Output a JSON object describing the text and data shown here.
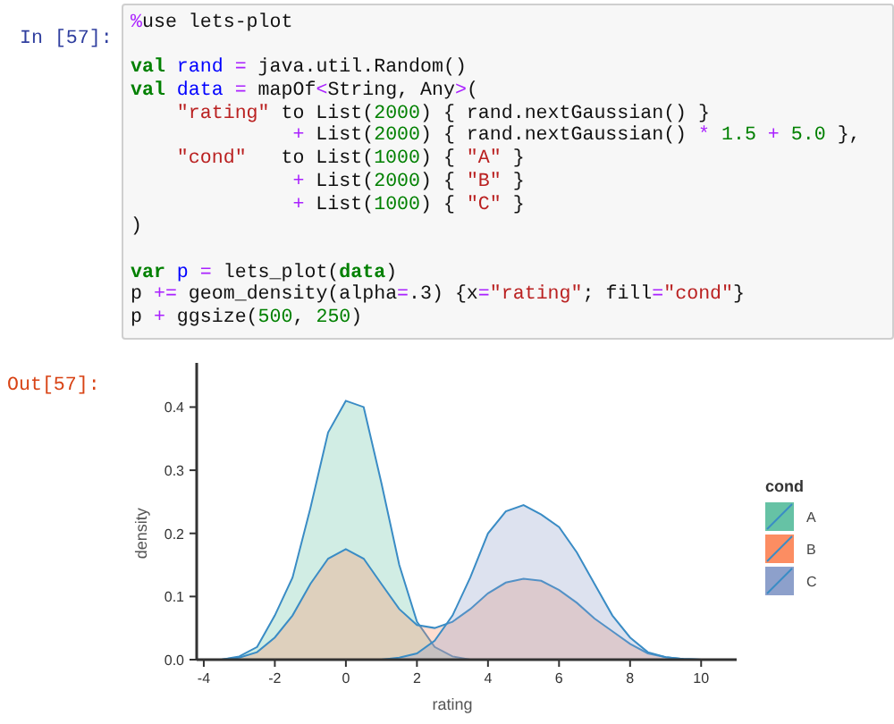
{
  "input_cell": {
    "prompt": "In [57]:",
    "lines": [
      {
        "tokens": [
          {
            "kind": "op",
            "text": "%"
          },
          {
            "kind": "plain",
            "text": "use lets-plot"
          }
        ]
      },
      {
        "blank_before": true,
        "tokens": [
          {
            "kind": "kw",
            "text": "val "
          },
          {
            "kind": "var",
            "text": "rand "
          },
          {
            "kind": "op",
            "text": "="
          },
          {
            "kind": "plain",
            "text": " java.util.Random()"
          }
        ]
      },
      {
        "tokens": [
          {
            "kind": "kw",
            "text": "val "
          },
          {
            "kind": "var",
            "text": "data "
          },
          {
            "kind": "op",
            "text": "="
          },
          {
            "kind": "plain",
            "text": " mapOf"
          },
          {
            "kind": "op",
            "text": "<"
          },
          {
            "kind": "plain",
            "text": "String, Any"
          },
          {
            "kind": "op",
            "text": ">"
          },
          {
            "kind": "plain",
            "text": "("
          }
        ]
      },
      {
        "tokens": [
          {
            "kind": "str",
            "text": "    \"rating\""
          },
          {
            "kind": "plain",
            "text": " to List("
          },
          {
            "kind": "num",
            "text": "2000"
          },
          {
            "kind": "plain",
            "text": ") { rand.nextGaussian() }"
          }
        ]
      },
      {
        "tokens": [
          {
            "kind": "op",
            "text": "              +"
          },
          {
            "kind": "plain",
            "text": " List("
          },
          {
            "kind": "num",
            "text": "2000"
          },
          {
            "kind": "plain",
            "text": ") { rand.nextGaussian() "
          },
          {
            "kind": "op",
            "text": "* "
          },
          {
            "kind": "num",
            "text": "1.5 "
          },
          {
            "kind": "op",
            "text": "+ "
          },
          {
            "kind": "num",
            "text": "5.0"
          },
          {
            "kind": "plain",
            "text": " },"
          }
        ]
      },
      {
        "tokens": [
          {
            "kind": "str",
            "text": "    \"cond\""
          },
          {
            "kind": "plain",
            "text": "   to List("
          },
          {
            "kind": "num",
            "text": "1000"
          },
          {
            "kind": "plain",
            "text": ") { "
          },
          {
            "kind": "str",
            "text": "\"A\""
          },
          {
            "kind": "plain",
            "text": " }"
          }
        ]
      },
      {
        "tokens": [
          {
            "kind": "op",
            "text": "              +"
          },
          {
            "kind": "plain",
            "text": " List("
          },
          {
            "kind": "num",
            "text": "2000"
          },
          {
            "kind": "plain",
            "text": ") { "
          },
          {
            "kind": "str",
            "text": "\"B\""
          },
          {
            "kind": "plain",
            "text": " }"
          }
        ]
      },
      {
        "tokens": [
          {
            "kind": "op",
            "text": "              +"
          },
          {
            "kind": "plain",
            "text": " List("
          },
          {
            "kind": "num",
            "text": "1000"
          },
          {
            "kind": "plain",
            "text": ") { "
          },
          {
            "kind": "str",
            "text": "\"C\""
          },
          {
            "kind": "plain",
            "text": " }"
          }
        ]
      },
      {
        "tokens": [
          {
            "kind": "plain",
            "text": ")"
          }
        ]
      },
      {
        "blank_before": true,
        "tokens": [
          {
            "kind": "kw",
            "text": "var "
          },
          {
            "kind": "var",
            "text": "p "
          },
          {
            "kind": "op",
            "text": "="
          },
          {
            "kind": "plain",
            "text": " lets_plot("
          },
          {
            "kind": "kw",
            "text": "data"
          },
          {
            "kind": "plain",
            "text": ")"
          }
        ]
      },
      {
        "tokens": [
          {
            "kind": "plain",
            "text": "p "
          },
          {
            "kind": "op",
            "text": "+="
          },
          {
            "kind": "plain",
            "text": " geom_density(alpha"
          },
          {
            "kind": "op",
            "text": "="
          },
          {
            "kind": "plain",
            "text": ".3) {x"
          },
          {
            "kind": "op",
            "text": "="
          },
          {
            "kind": "str",
            "text": "\"rating\""
          },
          {
            "kind": "plain",
            "text": "; fill"
          },
          {
            "kind": "op",
            "text": "="
          },
          {
            "kind": "str",
            "text": "\"cond\""
          },
          {
            "kind": "plain",
            "text": "}"
          }
        ]
      },
      {
        "tokens": [
          {
            "kind": "plain",
            "text": "p "
          },
          {
            "kind": "op",
            "text": "+"
          },
          {
            "kind": "plain",
            "text": " ggsize("
          },
          {
            "kind": "num",
            "text": "500"
          },
          {
            "kind": "plain",
            "text": ", "
          },
          {
            "kind": "num",
            "text": "250"
          },
          {
            "kind": "plain",
            "text": ")"
          }
        ]
      }
    ]
  },
  "output_cell": {
    "prompt": "Out[57]:",
    "chart_data": {
      "type": "area",
      "xlabel": "rating",
      "ylabel": "density",
      "legend": {
        "title": "cond"
      },
      "x": [
        -3.5,
        -3,
        -2.5,
        -2,
        -1.5,
        -1,
        -0.5,
        0,
        0.5,
        1,
        1.5,
        2,
        2.5,
        3,
        3.5,
        4,
        4.5,
        5,
        5.5,
        6,
        6.5,
        7,
        7.5,
        8,
        8.5,
        9,
        9.5,
        10,
        10.5
      ],
      "series": [
        {
          "name": "A",
          "color": "#66c2a5",
          "values": [
            0,
            0.005,
            0.02,
            0.07,
            0.13,
            0.24,
            0.36,
            0.41,
            0.4,
            0.28,
            0.15,
            0.06,
            0.02,
            0.005,
            0,
            0,
            0,
            0,
            0,
            0,
            0,
            0,
            0,
            0,
            0,
            0,
            0,
            0,
            0
          ]
        },
        {
          "name": "B",
          "color": "#fc8d62",
          "values": [
            0,
            0.003,
            0.012,
            0.035,
            0.07,
            0.12,
            0.16,
            0.175,
            0.16,
            0.12,
            0.08,
            0.055,
            0.05,
            0.06,
            0.08,
            0.105,
            0.122,
            0.128,
            0.125,
            0.11,
            0.09,
            0.065,
            0.045,
            0.025,
            0.01,
            0.004,
            0.001,
            0,
            0
          ]
        },
        {
          "name": "C",
          "color": "#8da0cb",
          "values": [
            0,
            0,
            0,
            0,
            0,
            0,
            0,
            0,
            0,
            0,
            0.003,
            0.01,
            0.03,
            0.07,
            0.13,
            0.2,
            0.235,
            0.245,
            0.23,
            0.21,
            0.17,
            0.12,
            0.07,
            0.035,
            0.012,
            0.004,
            0.001,
            0,
            0
          ]
        }
      ],
      "xlim": [
        -4.2,
        11
      ],
      "ylim": [
        0,
        0.47
      ],
      "xticks": [
        -4,
        -2,
        0,
        2,
        4,
        6,
        8,
        10
      ],
      "yticks": [
        {
          "value": 0,
          "label": "0.0"
        },
        {
          "value": 0.1,
          "label": "0.1"
        },
        {
          "value": 0.2,
          "label": "0.2"
        },
        {
          "value": 0.3,
          "label": "0.3"
        },
        {
          "value": 0.4,
          "label": "0.4"
        }
      ]
    }
  }
}
